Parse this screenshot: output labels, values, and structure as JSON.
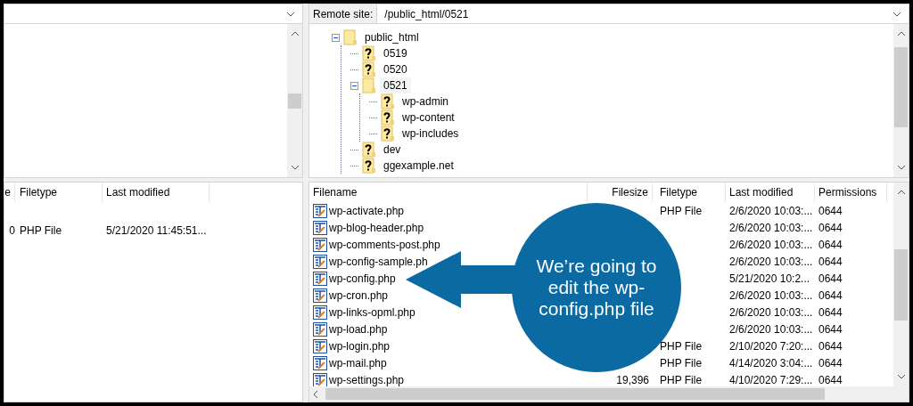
{
  "local_panel": {
    "columns": [
      "e",
      "Filetype",
      "Last modified"
    ],
    "rows": [
      {
        "column_1": "0",
        "filetype": "PHP File",
        "last_modified": "5/21/2020 11:45:51..."
      }
    ]
  },
  "remote_site": {
    "label": "Remote site:",
    "path": "/public_html/0521"
  },
  "remote_tree": [
    {
      "name": "public_html",
      "expanded": true,
      "unknown": false,
      "selected": false,
      "children": [
        {
          "name": "0519",
          "unknown": true,
          "selected": false
        },
        {
          "name": "0520",
          "unknown": true,
          "selected": false
        },
        {
          "name": "0521",
          "expanded": true,
          "unknown": false,
          "selected": true,
          "children": [
            {
              "name": "wp-admin",
              "unknown": true,
              "selected": false
            },
            {
              "name": "wp-content",
              "unknown": true,
              "selected": false
            },
            {
              "name": "wp-includes",
              "unknown": true,
              "selected": false
            }
          ]
        },
        {
          "name": "dev",
          "unknown": true,
          "selected": false
        },
        {
          "name": "ggexample.net",
          "unknown": true,
          "selected": false
        }
      ]
    }
  ],
  "remote_files": {
    "columns": [
      "Filename",
      "Filesize",
      "Filetype",
      "Last modified",
      "Permissions"
    ],
    "rows": [
      {
        "filename": "wp-activate.php",
        "filetype": "PHP File",
        "last_modified": "2/6/2020 10:03:...",
        "permissions": "0644"
      },
      {
        "filename": "wp-blog-header.php",
        "last_modified": "2/6/2020 10:03:...",
        "permissions": "0644"
      },
      {
        "filename": "wp-comments-post.php",
        "last_modified": "2/6/2020 10:03:...",
        "permissions": "0644"
      },
      {
        "filename": "wp-config-sample.ph",
        "last_modified": "2/6/2020 10:03:...",
        "permissions": "0644"
      },
      {
        "filename": "wp-config.php",
        "last_modified": "5/21/2020 10:2...",
        "permissions": "0644"
      },
      {
        "filename": "wp-cron.php",
        "last_modified": "2/6/2020 10:03:...",
        "permissions": "0644"
      },
      {
        "filename": "wp-links-opml.php",
        "last_modified": "2/6/2020 10:03:...",
        "permissions": "0644"
      },
      {
        "filename": "wp-load.php",
        "last_modified": "2/6/2020 10:03:...",
        "permissions": "0644"
      },
      {
        "filename": "wp-login.php",
        "filetype": "PHP File",
        "last_modified": "2/10/2020 7:20:...",
        "permissions": "0644"
      },
      {
        "filename": "wp-mail.php",
        "filetype": "PHP File",
        "last_modified": "4/14/2020 3:04:...",
        "permissions": "0644"
      },
      {
        "filename": "wp-settings.php",
        "filesize": "19,396",
        "filetype": "PHP File",
        "last_modified": "4/10/2020 7:29:...",
        "permissions": "0644"
      }
    ]
  },
  "callout": {
    "text": "We’re going to edit the wp-config.php file"
  }
}
